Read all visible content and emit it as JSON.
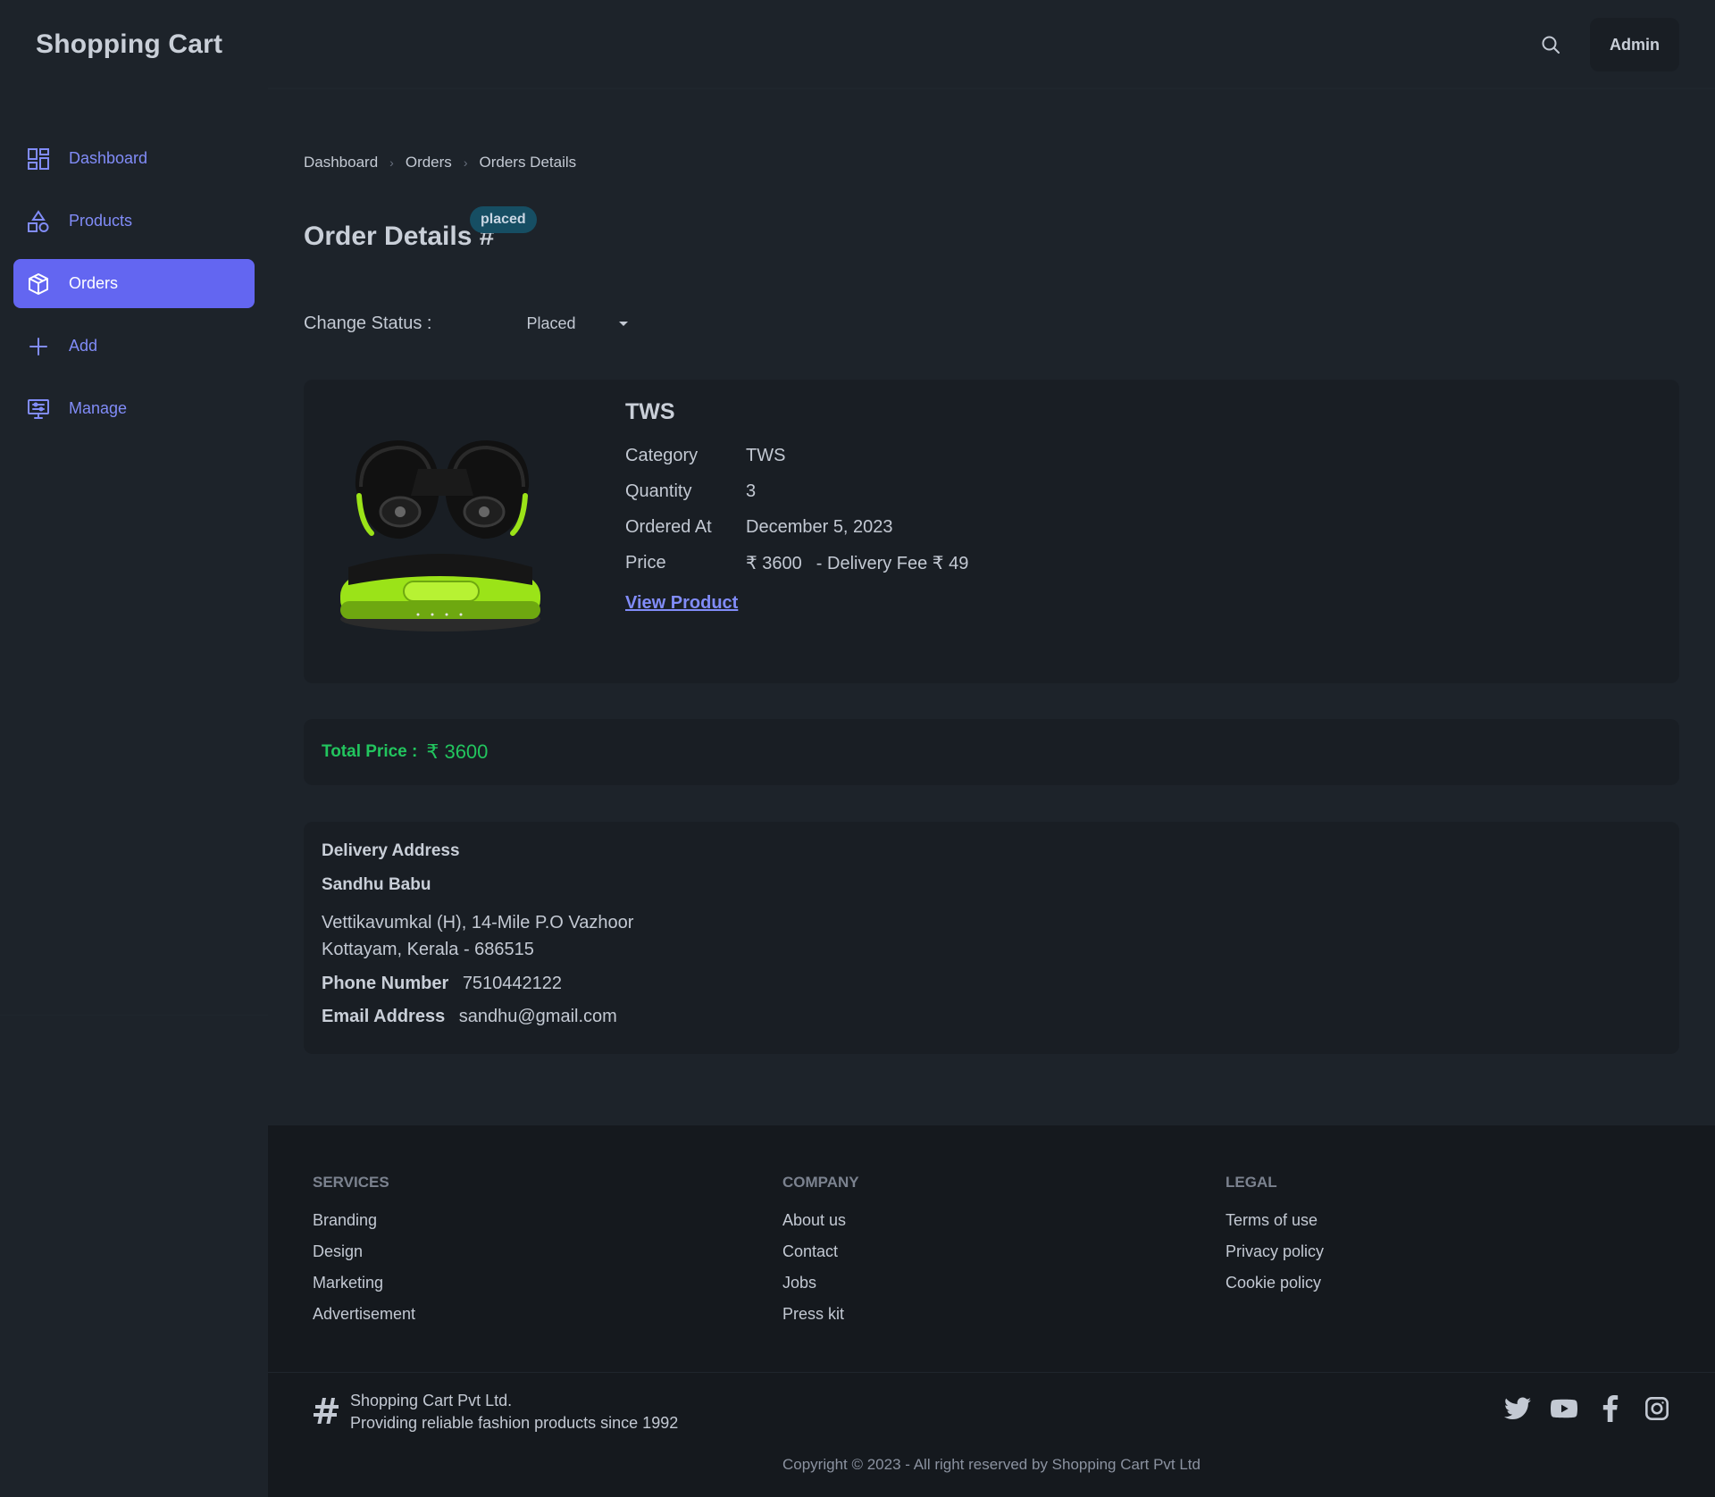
{
  "navbar": {
    "brand": "Shopping Cart",
    "admin_label": "Admin"
  },
  "sidebar": {
    "items": [
      {
        "label": "Dashboard",
        "icon": "dashboard-icon",
        "active": false
      },
      {
        "label": "Products",
        "icon": "shapes-icon",
        "active": false
      },
      {
        "label": "Orders",
        "icon": "box-icon",
        "active": true
      },
      {
        "label": "Add",
        "icon": "plus-icon",
        "active": false
      },
      {
        "label": "Manage",
        "icon": "monitor-icon",
        "active": false
      }
    ]
  },
  "breadcrumb": [
    "Dashboard",
    "Orders",
    "Orders Details"
  ],
  "page": {
    "title": "Order Details #",
    "status_badge": "placed",
    "change_status_label": "Change Status :",
    "status_value": "Placed"
  },
  "product": {
    "name": "TWS",
    "category_label": "Category",
    "category": "TWS",
    "quantity_label": "Quantity",
    "quantity": "3",
    "ordered_at_label": "Ordered At",
    "ordered_at": "December 5, 2023",
    "price_label": "Price",
    "price": "₹ 3600",
    "delivery_fee": "- Delivery Fee ₹ 49",
    "view_link": "View Product"
  },
  "total": {
    "label": "Total Price :",
    "value": "₹ 3600"
  },
  "address": {
    "heading": "Delivery Address",
    "name": "Sandhu Babu",
    "line1": "Vettikavumkal (H), 14-Mile P.O Vazhoor",
    "line2": "Kottayam, Kerala - 686515",
    "phone_label": "Phone Number",
    "phone": "7510442122",
    "email_label": "Email Address",
    "email": "sandhu@gmail.com"
  },
  "footer": {
    "services": {
      "title": "SERVICES",
      "links": [
        "Branding",
        "Design",
        "Marketing",
        "Advertisement"
      ]
    },
    "company": {
      "title": "COMPANY",
      "links": [
        "About us",
        "Contact",
        "Jobs",
        "Press kit"
      ]
    },
    "legal": {
      "title": "LEGAL",
      "links": [
        "Terms of use",
        "Privacy policy",
        "Cookie policy"
      ]
    },
    "company_name": "Shopping Cart Pvt Ltd.",
    "tagline": "Providing reliable fashion products since 1992",
    "social": [
      "twitter-icon",
      "youtube-icon",
      "facebook-icon",
      "instagram-icon"
    ],
    "copyright": "Copyright © 2023 - All right reserved by Shopping Cart Pvt Ltd"
  },
  "colors": {
    "accent": "#6366f1",
    "link": "#818cf8",
    "success": "#22c55e",
    "badge": "#164e63",
    "background": "#1d232a",
    "card": "#191e24"
  }
}
